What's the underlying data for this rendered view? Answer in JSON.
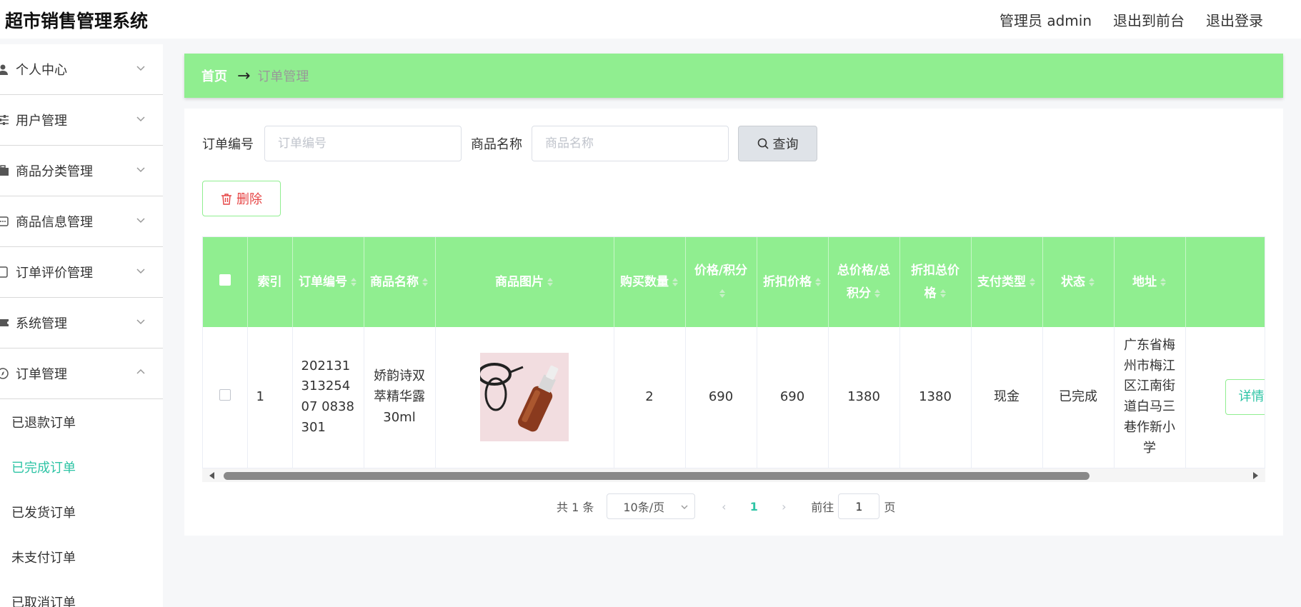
{
  "header": {
    "app_title": "超市销售管理系统",
    "admin_label": "管理员 admin",
    "to_frontend": "退出到前台",
    "logout": "退出登录"
  },
  "sidebar": {
    "menus": [
      {
        "label": "个人中心",
        "icon": "user-icon"
      },
      {
        "label": "用户管理",
        "icon": "sliders-icon"
      },
      {
        "label": "商品分类管理",
        "icon": "briefcase-icon"
      },
      {
        "label": "商品信息管理",
        "icon": "chat-dots-icon"
      },
      {
        "label": "订单评价管理",
        "icon": "tablet-icon"
      },
      {
        "label": "系统管理",
        "icon": "ticket-icon"
      },
      {
        "label": "订单管理",
        "icon": "compass-icon",
        "expanded": true
      }
    ],
    "submenu": [
      {
        "label": "已退款订单",
        "active": false
      },
      {
        "label": "已完成订单",
        "active": true
      },
      {
        "label": "已发货订单",
        "active": false
      },
      {
        "label": "未支付订单",
        "active": false
      },
      {
        "label": "已取消订单",
        "active": false
      }
    ]
  },
  "breadcrumb": {
    "home": "首页",
    "separator": "→",
    "current": "订单管理"
  },
  "search": {
    "order_no_label": "订单编号",
    "order_no_placeholder": "订单编号",
    "order_no_value": "",
    "product_name_label": "商品名称",
    "product_name_placeholder": "商品名称",
    "product_name_value": "",
    "query_button": "查询"
  },
  "actions": {
    "delete_button": "删除"
  },
  "table": {
    "headers": {
      "index": "索引",
      "order_no": "订单编号",
      "product_name": "商品名称",
      "product_image": "商品图片",
      "quantity": "购买数量",
      "price": "价格/积分",
      "discount_price": "折扣价格",
      "total": "总价格/总积分",
      "discount_total": "折扣总价格",
      "pay_type": "支付类型",
      "status": "状态",
      "address": "地址"
    },
    "rows": [
      {
        "index": "1",
        "order_no": "20213131325407 0838301",
        "product_name": "娇韵诗双萃精华露30ml",
        "image_icon": "serum-bottle-image",
        "quantity": "2",
        "price": "690",
        "discount_price": "690",
        "total": "1380",
        "discount_total": "1380",
        "pay_type": "现金",
        "status": "已完成",
        "address": "广东省梅州市梅江区江南街道白马三巷作新小学",
        "detail_button": "详情"
      }
    ]
  },
  "pagination": {
    "total_text": "共 1 条",
    "page_size": "10条/页",
    "current_page": "1",
    "goto_label": "前往",
    "goto_value": "1",
    "page_suffix": "页"
  },
  "colors": {
    "accent_green": "#90ee90",
    "active_teal": "#2ec4a5",
    "delete_red": "#e64545"
  }
}
